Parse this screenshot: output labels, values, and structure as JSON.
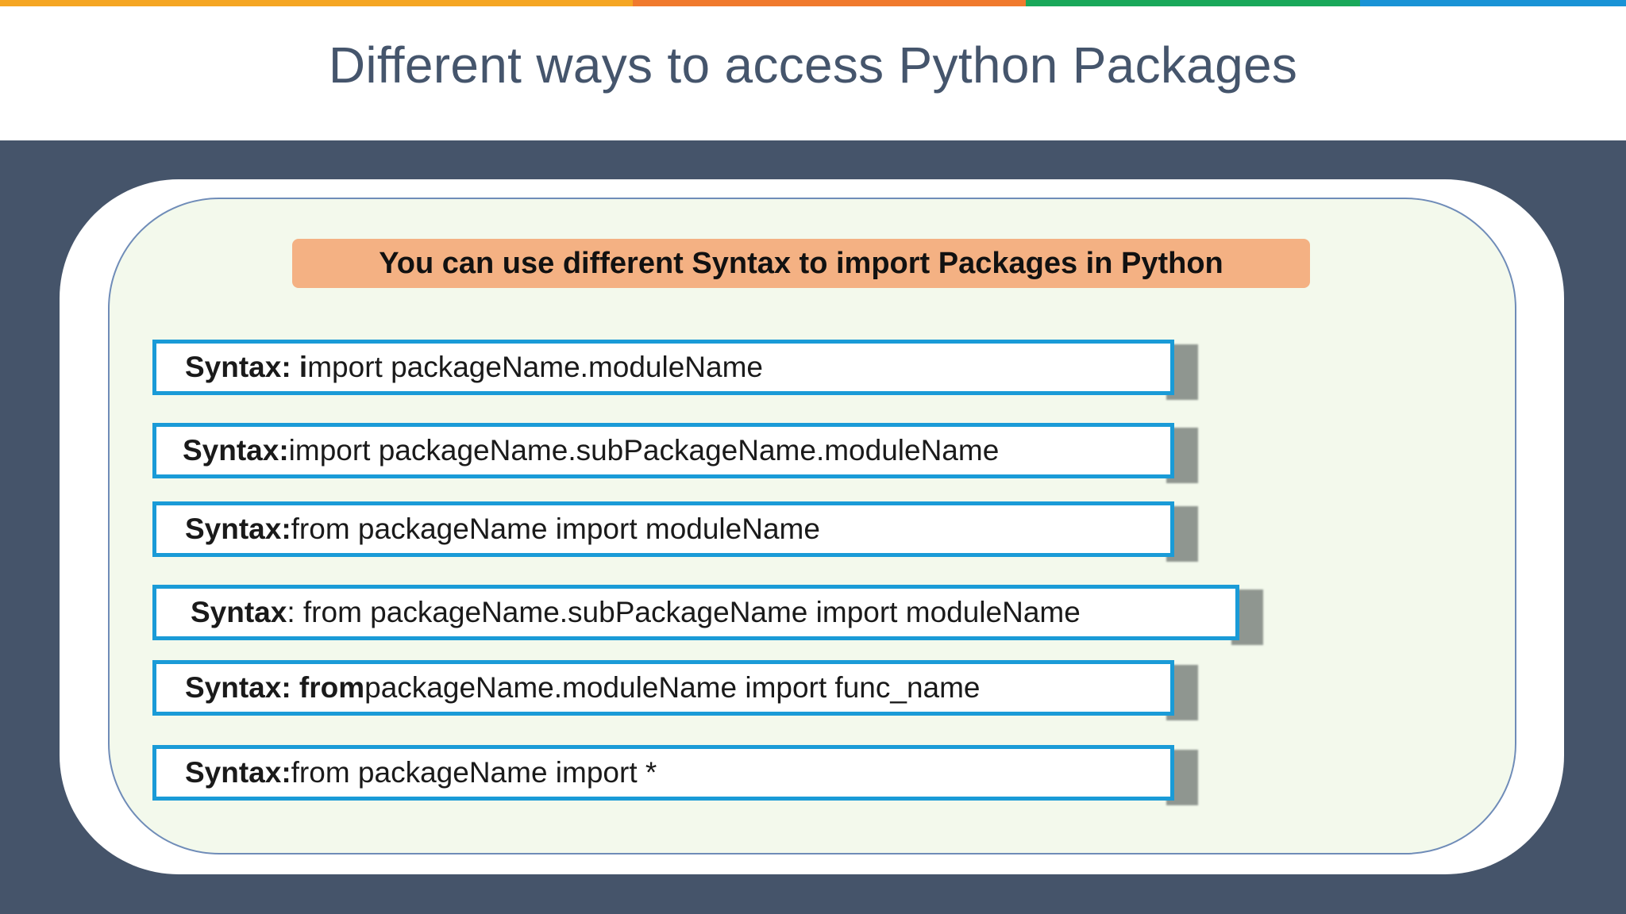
{
  "colors": {
    "stripe": [
      "#f5a623",
      "#f07a2e",
      "#1aa85a",
      "#1a93d6"
    ],
    "title_text": "#45556c",
    "body_band": "#45546a",
    "inner_panel": "#f3f9ec",
    "banner": "#f4b183",
    "row_border": "#1a9bd7"
  },
  "slide": {
    "title": "Different ways to access Python Packages",
    "banner": "You can use different Syntax to import Packages in Python"
  },
  "syntax_rows": [
    {
      "bold": "Syntax: i",
      "rest": "mport packageName.moduleName"
    },
    {
      "bold": "Syntax:",
      "rest": " import packageName.subPackageName.moduleName"
    },
    {
      "bold": "Syntax:",
      "rest": " from packageName import moduleName"
    },
    {
      "bold": "Syntax",
      "rest": ": from packageName.subPackageName import moduleName"
    },
    {
      "bold": "Syntax: from",
      "rest": " packageName.moduleName import func_name"
    },
    {
      "bold": "Syntax:",
      "rest": " from packageName import *"
    }
  ]
}
